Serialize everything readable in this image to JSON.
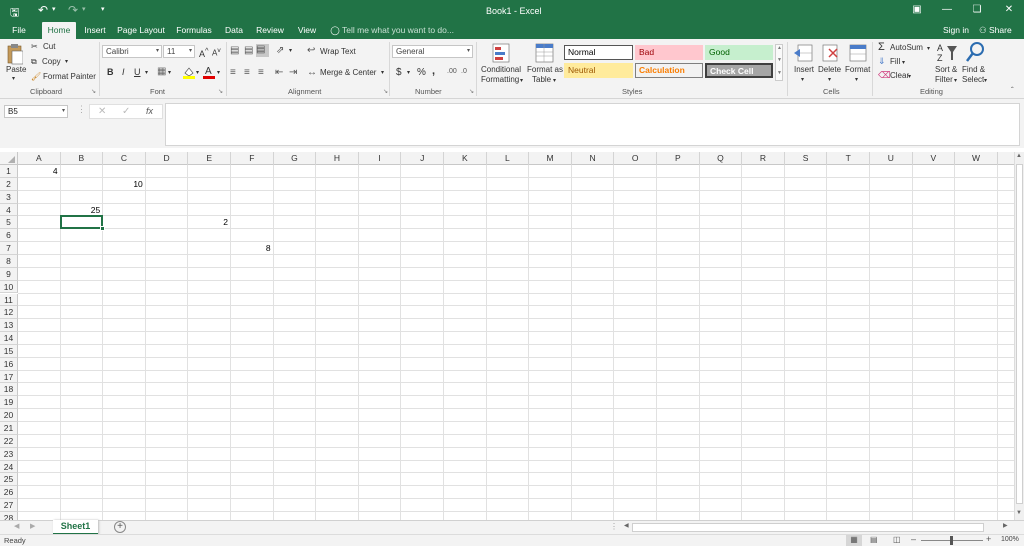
{
  "titlebar": {
    "title": "Book1 - Excel",
    "qat_more": "▾",
    "sign_in": "Sign in",
    "share": "Share"
  },
  "tabs": [
    "File",
    "Home",
    "Insert",
    "Page Layout",
    "Formulas",
    "Data",
    "Review",
    "View"
  ],
  "tell_me": "Tell me what you want to do...",
  "ribbon": {
    "clipboard": {
      "paste": "Paste",
      "cut": "Cut",
      "copy": "Copy",
      "format_painter": "Format Painter",
      "label": "Clipboard"
    },
    "font": {
      "name": "Calibri",
      "size": "11",
      "bold": "B",
      "italic": "I",
      "underline": "U",
      "grow": "A",
      "shrink": "A",
      "label": "Font"
    },
    "alignment": {
      "wrap": "Wrap Text",
      "merge": "Merge & Center",
      "label": "Alignment"
    },
    "number": {
      "format": "General",
      "currency": "$",
      "percent": "%",
      "comma": ",",
      "label": "Number"
    },
    "styles": {
      "cond_fmt_1": "Conditional",
      "cond_fmt_2": "Formatting",
      "fmt_table_1": "Format as",
      "fmt_table_2": "Table",
      "normal": "Normal",
      "bad": "Bad",
      "good": "Good",
      "neutral": "Neutral",
      "calculation": "Calculation",
      "check_cell": "Check Cell",
      "label": "Styles"
    },
    "cells": {
      "insert": "Insert",
      "delete": "Delete",
      "format": "Format",
      "label": "Cells"
    },
    "editing": {
      "autosum": "AutoSum",
      "fill": "Fill",
      "clear": "Clear",
      "sort_1": "Sort &",
      "sort_2": "Filter",
      "find_1": "Find &",
      "find_2": "Select",
      "label": "Editing"
    }
  },
  "formula_bar": {
    "name_box": "B5",
    "fx": "fx",
    "value": ""
  },
  "columns": [
    "A",
    "B",
    "C",
    "D",
    "E",
    "F",
    "G",
    "H",
    "I",
    "J",
    "K",
    "L",
    "M",
    "N",
    "O",
    "P",
    "Q",
    "R",
    "S",
    "T",
    "U",
    "V",
    "W"
  ],
  "rows": [
    "1",
    "2",
    "3",
    "4",
    "5",
    "6",
    "7",
    "8",
    "9",
    "10",
    "11",
    "12",
    "13",
    "14",
    "15",
    "16",
    "17",
    "18",
    "19",
    "20",
    "21",
    "22",
    "23",
    "24",
    "25",
    "26",
    "27",
    "28"
  ],
  "cells": [
    {
      "ref": "A1",
      "value": "4"
    },
    {
      "ref": "C2",
      "value": "10"
    },
    {
      "ref": "B4",
      "value": "25"
    },
    {
      "ref": "E5",
      "value": "2"
    },
    {
      "ref": "F7",
      "value": "8"
    }
  ],
  "selected_cell": "B5",
  "sheets": [
    "Sheet1"
  ],
  "status": {
    "ready": "Ready",
    "zoom": "100%"
  },
  "colors": {
    "brand": "#217346",
    "bad_bg": "#ffc7ce",
    "bad_fg": "#9c0006",
    "good_bg": "#c6efce",
    "good_fg": "#006100",
    "neutral_bg": "#ffeb9c",
    "neutral_fg": "#9c5700",
    "calc_fg": "#fa7d00",
    "check_bg": "#a5a5a5"
  }
}
